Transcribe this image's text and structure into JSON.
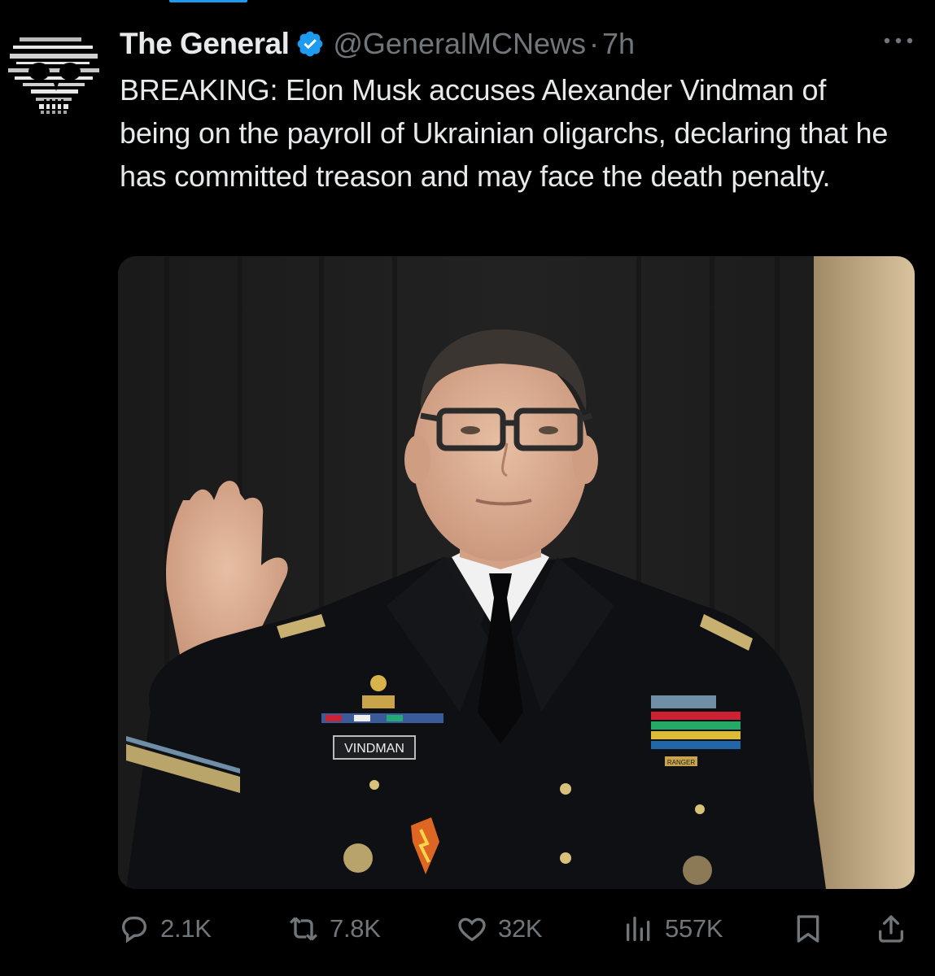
{
  "tweet": {
    "display_name": "The General",
    "verified_icon": "verified-badge-icon",
    "handle": "@GeneralMCNews",
    "separator": "·",
    "time": "7h",
    "text": "BREAKING: Elon Musk accuses Alexander Vindman of being on the payroll of Ukrainian oligarchs, declaring that he has committed treason and may face the death penalty.",
    "media": {
      "name_tag": "VINDMAN",
      "ranger_tab": "RANGER"
    }
  },
  "actions": {
    "replies": "2.1K",
    "reposts": "7.8K",
    "likes": "32K",
    "views": "557K"
  },
  "colors": {
    "background": "#000000",
    "text": "#e7e9ea",
    "muted": "#71767b",
    "accent": "#1d9bf0"
  }
}
